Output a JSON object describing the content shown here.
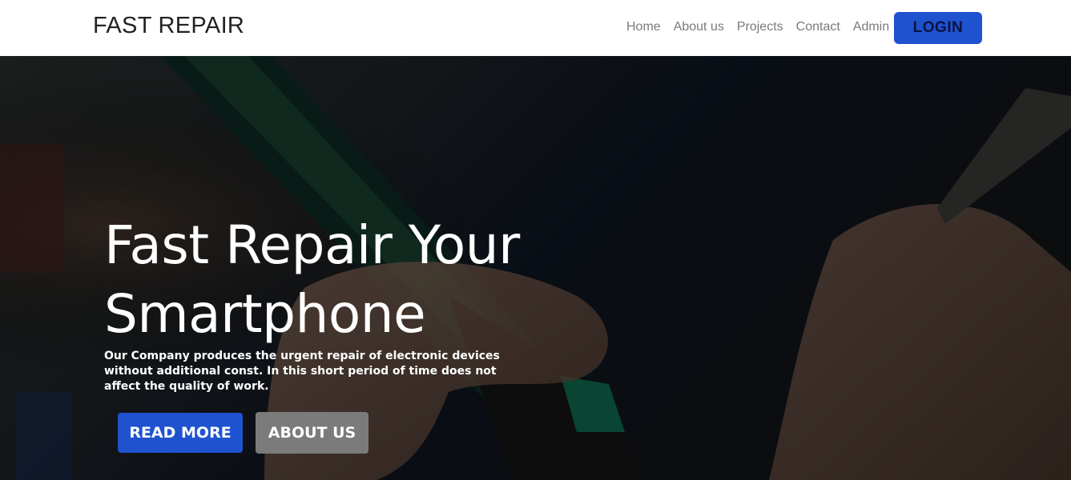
{
  "nav": {
    "brand": "FAST REPAIR",
    "links": [
      "Home",
      "About us",
      "Projects",
      "Contact",
      "Admin"
    ],
    "login_label": "LOGIN"
  },
  "hero": {
    "title": "Fast Repair Your Smartphone",
    "description": "Our Company produces the urgent repair of electronic devices without additional const. In this short period of time does not affect the quality of work.",
    "read_more_label": "READ MORE",
    "about_label": "ABOUT US"
  },
  "colors": {
    "accent": "#1f52cf",
    "secondary_button": "#7b7b7b",
    "navbar_bg": "#ffffff",
    "hero_text": "#ffffff"
  }
}
